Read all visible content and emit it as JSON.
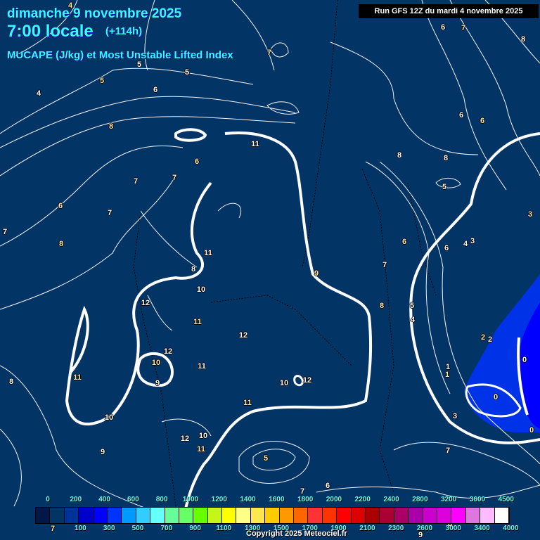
{
  "header": {
    "date": "dimanche 9 novembre 2025",
    "time": "7:00 locale",
    "offset": "(+114h)",
    "parameter": "MUCAPE (J/kg) et Most Unstable Lifted Index",
    "run": "Run GFS 12Z du mardi 4 novembre 2025"
  },
  "legend": {
    "top_labels": [
      "0",
      "200",
      "400",
      "600",
      "800",
      "1000",
      "1200",
      "1400",
      "1600",
      "1800",
      "2000",
      "2200",
      "2400",
      "2800",
      "3200",
      "3600",
      "4500"
    ],
    "bottom_labels": [
      "100",
      "300",
      "500",
      "700",
      "900",
      "1100",
      "1300",
      "1500",
      "1700",
      "1900",
      "2100",
      "2300",
      "2600",
      "3000",
      "3400",
      "4000"
    ],
    "colors": [
      "#001848",
      "#033466",
      "#003399",
      "#0000cc",
      "#0000ff",
      "#0033ff",
      "#0099ff",
      "#33ccff",
      "#66ffff",
      "#66ff99",
      "#66ff66",
      "#66ff00",
      "#c6f51a",
      "#ffff00",
      "#ffff88",
      "#ffe84d",
      "#ffcc00",
      "#ff9900",
      "#ff6600",
      "#ff3333",
      "#ff3300",
      "#ff0000",
      "#dd0000",
      "#aa0000",
      "#aa0033",
      "#aa0066",
      "#aa00aa",
      "#cc00cc",
      "#dd00dd",
      "#ff00ff",
      "#dd77dd",
      "#ffbbff",
      "#ffffff"
    ]
  },
  "lifted_index_labels": [
    "4",
    "5",
    "5",
    "5",
    "4",
    "6",
    "7",
    "8",
    "11",
    "6",
    "7",
    "7",
    "6",
    "7",
    "7",
    "8",
    "11",
    "8",
    "9",
    "10",
    "12",
    "11",
    "12",
    "12",
    "10",
    "9",
    "11",
    "11",
    "10",
    "12",
    "11",
    "10",
    "12",
    "11",
    "10",
    "9",
    "5",
    "7",
    "6",
    "8",
    "8",
    "8",
    "6",
    "6",
    "6",
    "7",
    "8",
    "5",
    "6",
    "4",
    "3",
    "3",
    "6",
    "7",
    "8",
    "5",
    "4",
    "2",
    "2",
    "1",
    "1",
    "0",
    "0",
    "0",
    "3",
    "7",
    "9",
    "9",
    "8",
    "7"
  ],
  "copyright": "Copyright 2025 Meteociel.fr",
  "colors": {
    "background": "#033466",
    "title": "#33ffff",
    "contour": "#ffffff"
  }
}
